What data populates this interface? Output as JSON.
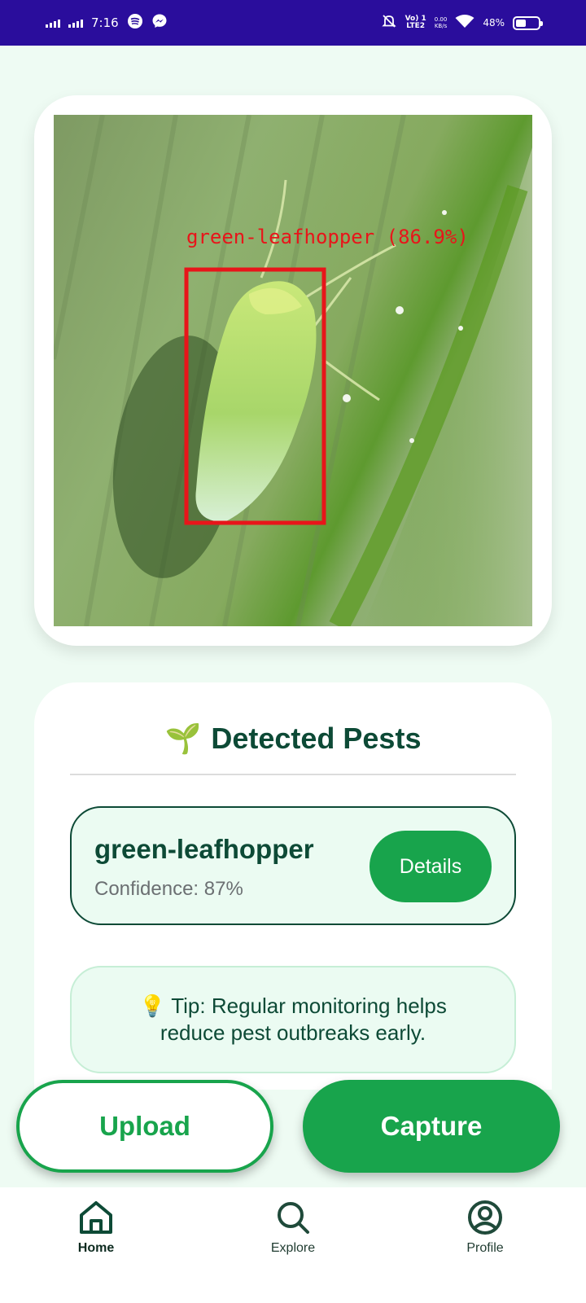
{
  "status_bar": {
    "time": "7:16",
    "network_line1": "Vo) 1",
    "network_line2": "LTE2",
    "speed_value": "0.00",
    "speed_unit": "KB/s",
    "battery": "48%",
    "battery_level": 0.48
  },
  "image_card": {
    "detection_label": "green-leafhopper (86.9%)",
    "box_color": "#e8151a"
  },
  "results": {
    "title": "Detected Pests",
    "title_emoji": "🌱",
    "pests": [
      {
        "name": "green-leafhopper",
        "confidence_label": "Confidence: 87%",
        "details_label": "Details"
      }
    ],
    "tip": "💡 Tip: Regular monitoring helps reduce pest outbreaks early."
  },
  "actions": {
    "upload_label": "Upload",
    "capture_label": "Capture"
  },
  "nav": {
    "items": [
      {
        "label": "Home",
        "icon": "home-icon",
        "active": true
      },
      {
        "label": "Explore",
        "icon": "search-icon",
        "active": false
      },
      {
        "label": "Profile",
        "icon": "profile-icon",
        "active": false
      }
    ]
  },
  "colors": {
    "status_bar": "#2a0d9c",
    "background": "#eefbf3",
    "primary_green": "#18a44c",
    "dark_green": "#0d4a36"
  }
}
